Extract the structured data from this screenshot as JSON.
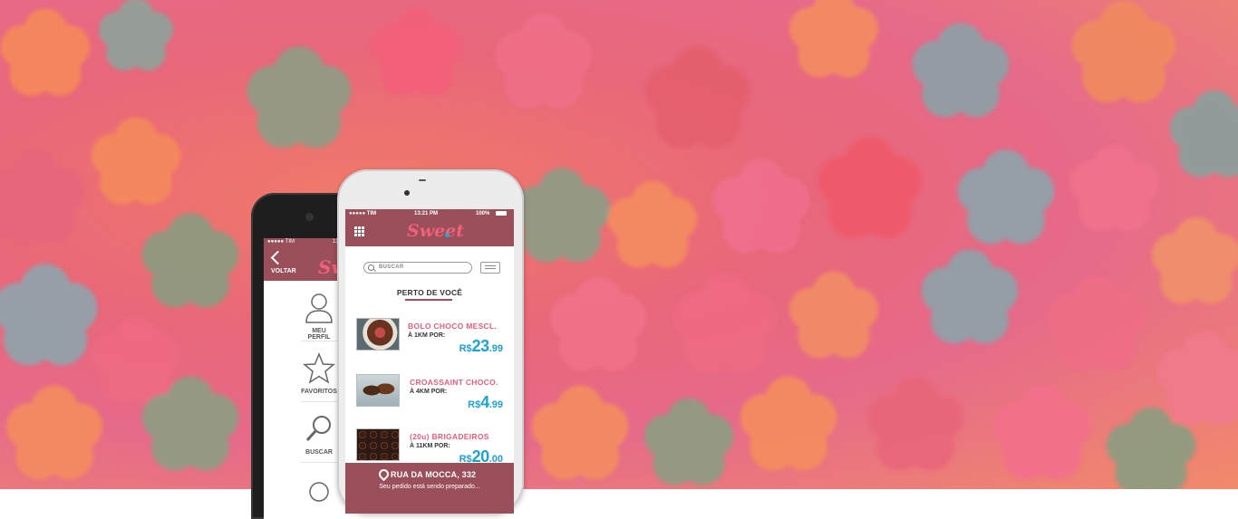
{
  "back_phone": {
    "status_bar": {
      "carrier": "●●●●● TIM",
      "time": "13"
    },
    "header": {
      "back_label": "VOLTAR",
      "logo": "Swt"
    },
    "menu": [
      {
        "label": "MEU PERFIL",
        "icon": "user-icon"
      },
      {
        "label": "FAVORITOS",
        "icon": "star-icon"
      },
      {
        "label": "BUSCAR",
        "icon": "search-icon"
      },
      {
        "label": "",
        "icon": "circle-icon"
      }
    ]
  },
  "front_phone": {
    "status_bar": {
      "carrier": "●●●●● TIM",
      "time": "13:21 PM",
      "battery": "100%"
    },
    "header": {
      "logo": "Sweet",
      "menu_icon": "grid-icon"
    },
    "search": {
      "placeholder": "BUSCAR",
      "filter_icon": "filter-icon"
    },
    "section_title": "PERTO DE VOCÊ",
    "products": [
      {
        "name": "BOLO CHOCO MESCL.",
        "distance": "À 1KM POR:",
        "currency": "R$",
        "price_int": "23",
        "price_dec": ".99"
      },
      {
        "name": "CROASSAINT CHOCO.",
        "distance": "À 4KM POR:",
        "currency": "R$",
        "price_int": "4",
        "price_dec": ".99"
      },
      {
        "name": "(20u) BRIGADEIROS",
        "distance": "À 11KM POR:",
        "currency": "R$",
        "price_int": "20",
        "price_dec": ".00"
      }
    ],
    "bottom_bar": {
      "address": "RUA DA MOCCA, 332",
      "order_status": "Seu pedido está sendo preparado..."
    }
  },
  "colors": {
    "brand": "#9b4f5a",
    "accent_pink": "#ef5a76",
    "price_blue": "#1aa3d3"
  }
}
